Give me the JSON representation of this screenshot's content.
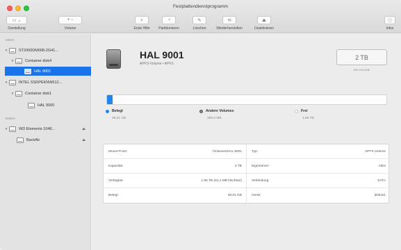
{
  "window": {
    "title": "Festplattendienstprogramm"
  },
  "toolbar": {
    "darstellung_label": "Darstellung",
    "darstellung_glyph": "▭ ⌄",
    "volume_label": "Volume",
    "volume_glyph": "+  −",
    "actions": [
      {
        "label": "Erste Hilfe",
        "icon": "stethoscope-icon",
        "glyph": "⚕"
      },
      {
        "label": "Partitionieren",
        "icon": "partition-icon",
        "glyph": "◔"
      },
      {
        "label": "Löschen",
        "icon": "erase-icon",
        "glyph": "✎"
      },
      {
        "label": "Wiederherstellen",
        "icon": "restore-icon",
        "glyph": "⟲"
      },
      {
        "label": "Deaktivieren",
        "icon": "unmount-icon",
        "glyph": "⏏"
      }
    ],
    "info_label": "Infos",
    "info_glyph": "ⓘ"
  },
  "sidebar": {
    "section_intern": "Intern",
    "section_extern": "Extern",
    "items": [
      {
        "label": "ST2000DM008-2G41...",
        "expanded": true
      },
      {
        "label": "Container disk4",
        "expanded": true
      },
      {
        "label": "HAL 9001",
        "selected": true
      },
      {
        "label": "INTEL SSDPEKNW512...",
        "expanded": true
      },
      {
        "label": "Container disk1",
        "expanded": true
      },
      {
        "label": "HAL 9000"
      },
      {
        "label": "WD Elements 1048...",
        "expanded": true,
        "eject": "⏏"
      },
      {
        "label": "BackAb",
        "eject": "⏏"
      }
    ]
  },
  "volume": {
    "name": "HAL 9001",
    "subtitle": "APFS-Volume • APFS",
    "capacity": "2 TB",
    "capacity_sub": "EIN VOLUME"
  },
  "usage": {
    "used_fraction": 0.02,
    "colors": {
      "used": "#1c87f1",
      "other": "#8a8a8a",
      "free": "#ffffff"
    },
    "legend": [
      {
        "label": "Belegt",
        "value": "38,01 GB"
      },
      {
        "label": "Andere Volumes",
        "value": "299,6 MB"
      },
      {
        "label": "Frei",
        "value": "1,96 TB"
      }
    ]
  },
  "info": {
    "rows": [
      {
        "k1": "Mount-Point:",
        "v1": "/Volumes/HAL 9001",
        "k2": "Typ:",
        "v2": "APFS-Volume"
      },
      {
        "k1": "Kapazität:",
        "v1": "2 TB",
        "k2": "Eigentümer:",
        "v2": "Aktiv"
      },
      {
        "k1": "Verfügbar:",
        "v1": "1,96 TB (61,1 MB löschbar)",
        "k2": "Verbindung:",
        "v2": "SATA"
      },
      {
        "k1": "Belegt:",
        "v1": "38,01 GB",
        "k2": "Gerät:",
        "v2": "disk4s1"
      }
    ]
  }
}
